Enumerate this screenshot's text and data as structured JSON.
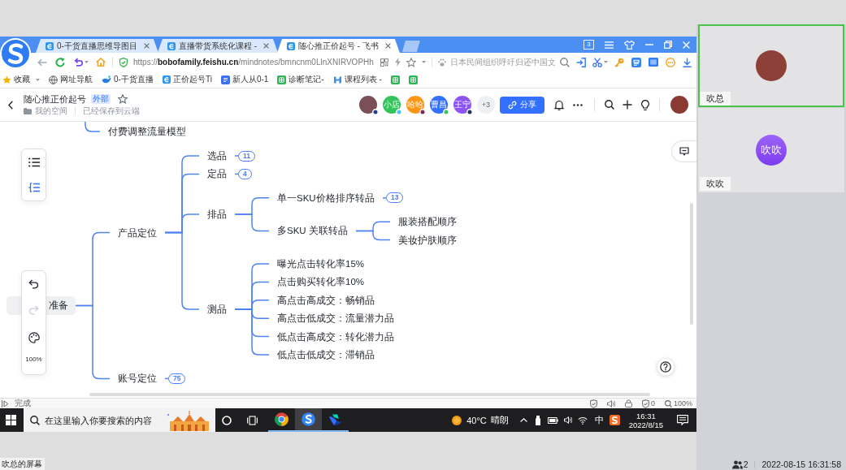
{
  "browser": {
    "tabs": [
      {
        "title": "0-干货直播思维导图目",
        "selected": false
      },
      {
        "title": "直播带货系统化课程 -",
        "selected": false
      },
      {
        "title": "随心推正价起号 - 飞书",
        "selected": true
      }
    ],
    "window_count": "3",
    "address": "https://**bobofamily.feishu.cn**/mindnotes/bmncnm0LlnXNIRVOPHh",
    "search": {
      "placeholder": "日本民间组织呼吁归还中国文"
    },
    "bookmarks": [
      {
        "kind": "star",
        "label": "收藏",
        "dropdown": true
      },
      {
        "kind": "globe",
        "label": "网址导航",
        "dropdown": false
      },
      {
        "kind": "bird",
        "label": "0-干货直播",
        "dropdown": false
      },
      {
        "kind": "doc",
        "label": "正价起号Ti",
        "dropdown": false
      },
      {
        "kind": "note",
        "label": "新人从0-1",
        "dropdown": false
      },
      {
        "kind": "sheet",
        "label": "诊断笔记-",
        "dropdown": false
      },
      {
        "kind": "logo",
        "label": "课程列表 -",
        "dropdown": false
      },
      {
        "kind": "sheet",
        "dropdown": false
      },
      {
        "kind": "sheet",
        "dropdown": false
      }
    ],
    "status_text": "完成",
    "blocked_count": "0",
    "zoom": "100%"
  },
  "document": {
    "title": "随心推正价起号",
    "tag": "外部",
    "location": "我的空间",
    "save_status": "已经保存到云端",
    "collaborators": [
      {
        "kind": "photo",
        "status_dot": {
          "color": "#2c3e8f"
        }
      },
      {
        "kind": "initials",
        "name": "小店",
        "color": "#34c25a",
        "status_dot": {
          "color": "#52c0f5"
        }
      },
      {
        "kind": "initials",
        "name": "哈哈",
        "color": "#ff9517",
        "status_dot": {
          "color": "#7a2a57"
        }
      },
      {
        "kind": "initials",
        "name": "曹昌",
        "color": "#3370ff",
        "status_dot": {
          "color": "#3fc45a"
        }
      },
      {
        "kind": "initials",
        "name": "王宁",
        "color": "#8d55f0",
        "status_dot": {
          "color": "#23355c"
        }
      }
    ],
    "more_collaborators": "+3",
    "share_label": "分享"
  },
  "mindmap": {
    "view_modes": [
      {
        "kind": "outline",
        "selected": false
      },
      {
        "kind": "mindmap",
        "selected": true
      }
    ],
    "history": [
      {
        "kind": "undo",
        "disabled": false
      },
      {
        "kind": "redo",
        "disabled": true
      }
    ],
    "zoom": "100%",
    "partial_node": {
      "label": "付费调整流量模型"
    },
    "root": {
      "label": "准备",
      "children": [
        {
          "label": "产品定位",
          "children": [
            {
              "label": "选品",
              "collapsed_count": "11"
            },
            {
              "label": "定品",
              "collapsed_count": "4"
            },
            {
              "label": "排品",
              "children": [
                {
                  "label": "单一SKU价格排序转品",
                  "collapsed_count": "13"
                },
                {
                  "label": "多SKU 关联转品",
                  "children": [
                    {
                      "label": "服装搭配顺序"
                    },
                    {
                      "label": "美妆护肤顺序"
                    }
                  ]
                }
              ]
            },
            {
              "label": "测品",
              "children": [
                {
                  "label": "曝光点击转化率15%"
                },
                {
                  "label": "点击购买转化率10%"
                },
                {
                  "label": "高点击高成交：畅销品"
                },
                {
                  "label": "高点击低成交：流量潜力品"
                },
                {
                  "label": "低点击高成交：转化潜力品"
                },
                {
                  "label": "低点击低成交：滞销品"
                }
              ]
            }
          ]
        },
        {
          "label": "账号定位",
          "collapsed_count": "75"
        }
      ]
    }
  },
  "taskbar": {
    "search": {
      "placeholder": "在这里输入你要搜索的内容"
    },
    "apps": [
      {
        "kind": "chrome",
        "active": false
      },
      {
        "kind": "sogou",
        "active": true
      },
      {
        "kind": "feishu",
        "active": false
      }
    ],
    "weather": {
      "temperature": "40°C",
      "condition": "晴朗"
    },
    "input_method": "中",
    "time": "16:31",
    "date": "2022/8/15"
  },
  "screen_label": "吹总的屏幕",
  "meeting": {
    "participants": [
      {
        "name": "吹总",
        "kind": "photo",
        "speaking": true
      },
      {
        "name": "吹吹",
        "kind": "initials",
        "initials": "吹吹",
        "speaking": false
      }
    ],
    "participant_count": "2",
    "timestamp": "2022-08-15 16:31:58"
  }
}
